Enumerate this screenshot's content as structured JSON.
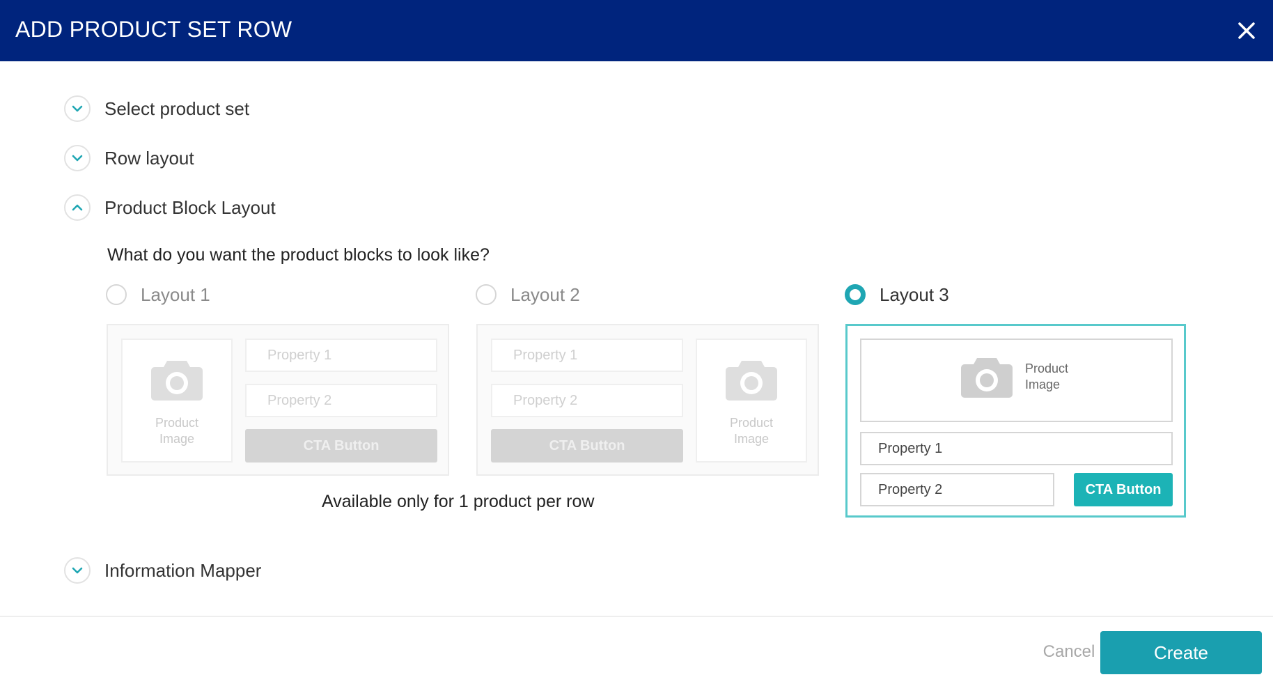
{
  "dialog": {
    "title": "ADD PRODUCT SET ROW"
  },
  "sections": [
    {
      "label": "Select product set",
      "state": "collapsed"
    },
    {
      "label": "Row layout",
      "state": "collapsed"
    },
    {
      "label": "Product Block Layout",
      "state": "expanded"
    },
    {
      "label": "Information Mapper",
      "state": "collapsed"
    }
  ],
  "product_block_layout": {
    "question": "What do you want the product blocks to look like?",
    "note": "Available only for 1 product per row",
    "selected": "Layout 3",
    "options": [
      {
        "label": "Layout 1",
        "selected": false,
        "image_label": "Product Image",
        "property_1": "Property 1",
        "property_2": "Property 2",
        "cta": "CTA Button"
      },
      {
        "label": "Layout 2",
        "selected": false,
        "image_label": "Product Image",
        "property_1": "Property 1",
        "property_2": "Property 2",
        "cta": "CTA Button"
      },
      {
        "label": "Layout 3",
        "selected": true,
        "image_label": "Product Image",
        "property_1": "Property 1",
        "property_2": "Property 2",
        "cta": "CTA Button"
      }
    ]
  },
  "footer": {
    "cancel_label": "Cancel",
    "create_label": "Create"
  },
  "colors": {
    "header_bg": "#00247d",
    "accent": "#1fa6b3",
    "create_button": "#1a9faf",
    "cta_active": "#1cb3b6"
  }
}
